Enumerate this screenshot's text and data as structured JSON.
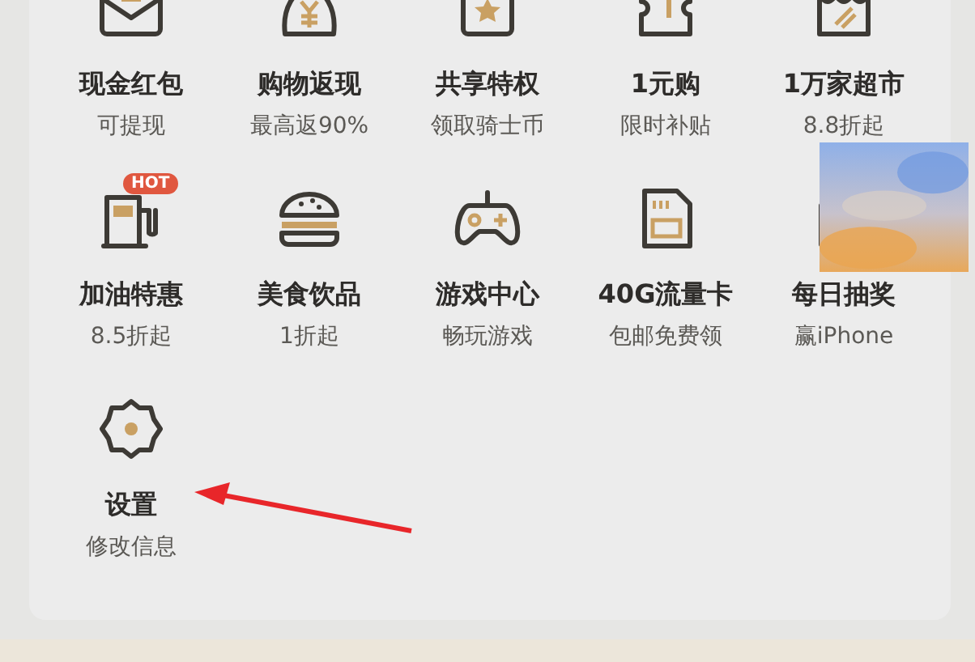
{
  "services": [
    {
      "kind": "envelope",
      "title": "现金红包",
      "subtitle": "可提现"
    },
    {
      "kind": "moneybag",
      "title": "购物返现",
      "subtitle": "最高返90%"
    },
    {
      "kind": "star-card",
      "title": "共享特权",
      "subtitle": "领取骑士币"
    },
    {
      "kind": "ticket",
      "title": "1元购",
      "subtitle": "限时补贴"
    },
    {
      "kind": "store",
      "title": "1万家超市",
      "subtitle": "8.8折起"
    },
    {
      "kind": "fuel",
      "title": "加油特惠",
      "subtitle": "8.5折起",
      "badge": "HOT"
    },
    {
      "kind": "burger",
      "title": "美食饮品",
      "subtitle": "1折起"
    },
    {
      "kind": "gamepad",
      "title": "游戏中心",
      "subtitle": "畅玩游戏"
    },
    {
      "kind": "sim",
      "title": "40G流量卡",
      "subtitle": "包邮免费领"
    },
    {
      "kind": "blurred",
      "title": "每日抽奖",
      "subtitle": "赢iPhone"
    },
    {
      "kind": "gear",
      "title": "设置",
      "subtitle": "修改信息"
    }
  ]
}
